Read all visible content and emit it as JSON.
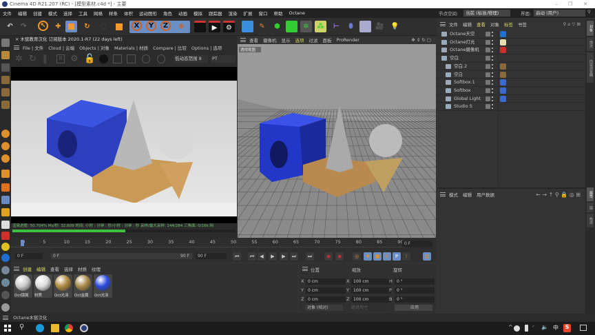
{
  "window": {
    "title": "Cinema 4D R21.207 (RC) - [模型素材.c4d *] - 主要",
    "minimize": "–",
    "maximize": "❐",
    "close": "✕"
  },
  "menu": [
    "文件",
    "编辑",
    "创建",
    "模式",
    "选择",
    "工具",
    "网格",
    "样条",
    "体积",
    "运动图形",
    "角色",
    "动画",
    "模拟",
    "跟踪器",
    "渲染",
    "扩展",
    "窗口",
    "帮助",
    "Octane"
  ],
  "node_space": {
    "label": "节点空间:",
    "value": "当前 (标准/物理)"
  },
  "layout": {
    "label": "界面:",
    "value": "启动 (用户)"
  },
  "toolbar_icons": [
    "undo-icon",
    "redo-icon",
    "select-icon",
    "move-icon",
    "scale-icon",
    "rotate-icon",
    "recent-icon",
    "live-select-icon",
    "x-axis-icon",
    "y-axis-icon",
    "z-axis-icon",
    "coordinate-system-icon",
    "render-view-icon",
    "render-picture-viewer-icon",
    "render-settings-icon",
    "cube-icon",
    "pen-icon",
    "subdivision-icon",
    "extrude-icon",
    "cloner-icon",
    "array-icon",
    "deformer-icon",
    "field-icon",
    "floor-icon",
    "camera-icon",
    "light-icon"
  ],
  "octane": {
    "title": "木窖教育汉化 订阅版本 2020.1-R7 (22 days left)",
    "menu": [
      "File | 文件",
      "Cloud | 云端",
      "Objects | 对象",
      "Materials | 材质",
      "Compare | 比较",
      "Options | 选项"
    ],
    "range": "低动态范围 8",
    "mode": "PT",
    "status": "渲染进度: 50.704%  Ms/秒: 32.609  时间: 小时 : 分钟 : 秒/小时 : 分钟 : 秒  采样/最大采样: 144/284  三角面: 0/16k  网",
    "progress": 50.704,
    "progress_color": "#3fbf3f"
  },
  "viewport": {
    "menu": [
      "查看",
      "摄像机",
      "显示",
      "选项",
      "过滤",
      "面板",
      "ProRender"
    ],
    "active_menu": "选项",
    "label": "透视视图"
  },
  "objects": {
    "menu": [
      "文件",
      "编辑",
      "查看",
      "对象",
      "标签",
      "书签"
    ],
    "items": [
      {
        "name": "Octane天空",
        "indent": 0,
        "tag": "#1d6fd1"
      },
      {
        "name": "Octane灯光",
        "indent": 0,
        "tag": "#e8e0b0"
      },
      {
        "name": "Octane摄像机",
        "indent": 0,
        "tag": "#d0302a"
      },
      {
        "name": "空白",
        "indent": 0,
        "tag": ""
      },
      {
        "name": "空白.2",
        "indent": 1,
        "tag": "#8a6a3a"
      },
      {
        "name": "空白",
        "indent": 1,
        "tag": "#8a6a3a"
      },
      {
        "name": "Softbox.1",
        "indent": 1,
        "tag": "#3a6ad0"
      },
      {
        "name": "Softbox",
        "indent": 1,
        "tag": "#3a6ad0"
      },
      {
        "name": "Global Light",
        "indent": 1,
        "tag": "#3a6ad0"
      },
      {
        "name": "Studio S",
        "indent": 1,
        "tag": ""
      }
    ]
  },
  "attributes": {
    "menu": [
      "模式",
      "编辑",
      "用户数据"
    ]
  },
  "right_tabs": [
    "对象",
    "场次",
    "内容浏览器",
    "属性",
    "层",
    "构造"
  ],
  "timeline": {
    "ticks": [
      "0",
      "5",
      "10",
      "15",
      "20",
      "25",
      "30",
      "35",
      "40",
      "45",
      "50",
      "55",
      "60",
      "65",
      "70",
      "75",
      "80",
      "85",
      "90"
    ],
    "current_frame": "0 F",
    "start": "0 F",
    "range_start": "0 F",
    "range_end": "90 F",
    "end": "90 F"
  },
  "materials": {
    "menu": [
      "创建",
      "编辑",
      "查看",
      "选择",
      "材质",
      "纹理"
    ],
    "items": [
      {
        "name": "Oct镜面",
        "color": "#ccc"
      },
      {
        "name": "材质",
        "color": "#ddd"
      },
      {
        "name": "Oct光泽",
        "color": "#b08a40"
      },
      {
        "name": "Oct金属",
        "color": "#a88a48"
      },
      {
        "name": "Oct光泽",
        "color": "#2a4ae0"
      }
    ]
  },
  "coords": {
    "headers": [
      "位置",
      "缩放",
      "旋转"
    ],
    "rows": [
      {
        "a": "X",
        "pos": "0 cm",
        "s": "X",
        "scale": "100 cm",
        "r": "H",
        "rot": "0 °"
      },
      {
        "a": "Y",
        "pos": "0 cm",
        "s": "Y",
        "scale": "100 cm",
        "r": "P",
        "rot": "0 °"
      },
      {
        "a": "Z",
        "pos": "0 cm",
        "s": "Z",
        "scale": "100 cm",
        "r": "B",
        "rot": "0 °"
      }
    ],
    "mode": "对象 (相对)",
    "size_mode": "绝对尺寸",
    "apply": "应用"
  },
  "status": "Octane木窖汉化",
  "taskbar": {
    "ime": "中"
  }
}
